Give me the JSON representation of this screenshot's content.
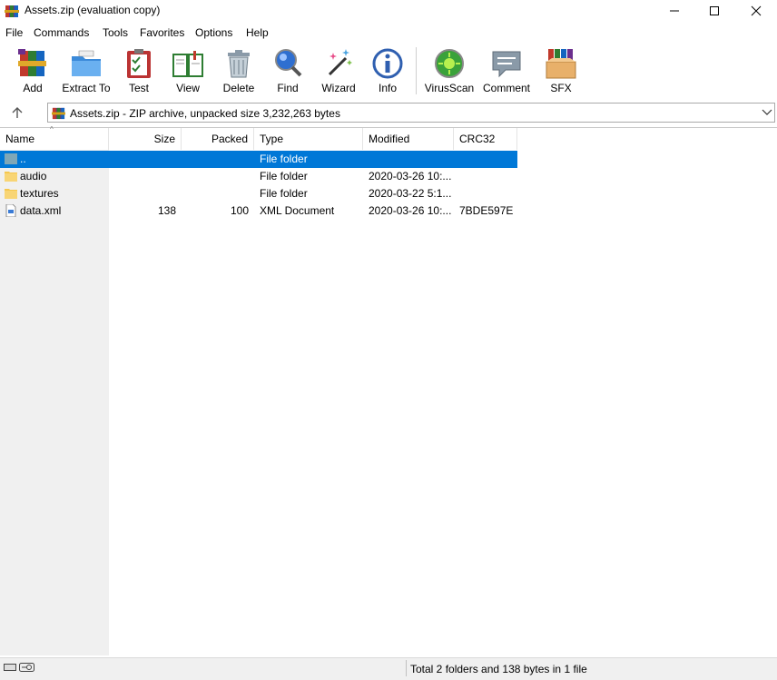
{
  "window": {
    "title": "Assets.zip (evaluation copy)",
    "icons": [
      "winrar-icon",
      "minimize-icon",
      "maximize-icon",
      "close-icon"
    ]
  },
  "menu": [
    "File",
    "Commands",
    "Tools",
    "Favorites",
    "Options",
    "Help"
  ],
  "toolbar": [
    {
      "label": "Add",
      "icon": "add-archive-icon"
    },
    {
      "label": "Extract To",
      "icon": "extract-folder-icon"
    },
    {
      "label": "Test",
      "icon": "test-clipboard-icon"
    },
    {
      "label": "View",
      "icon": "view-book-icon"
    },
    {
      "label": "Delete",
      "icon": "trash-icon"
    },
    {
      "label": "Find",
      "icon": "magnifier-icon"
    },
    {
      "label": "Wizard",
      "icon": "magic-wand-icon"
    },
    {
      "label": "Info",
      "icon": "info-icon"
    },
    {
      "label": "VirusScan",
      "icon": "virus-scan-icon"
    },
    {
      "label": "Comment",
      "icon": "comment-icon"
    },
    {
      "label": "SFX",
      "icon": "sfx-box-icon"
    }
  ],
  "address": {
    "text": "Assets.zip - ZIP archive, unpacked size 3,232,263 bytes"
  },
  "columns": [
    "Name",
    "Size",
    "Packed",
    "Type",
    "Modified",
    "CRC32"
  ],
  "rows": [
    {
      "name": "..",
      "size": "",
      "packed": "",
      "type": "File folder",
      "modified": "",
      "crc": "",
      "kind": "parent"
    },
    {
      "name": "audio",
      "size": "",
      "packed": "",
      "type": "File folder",
      "modified": "2020-03-26 10:...",
      "crc": "",
      "kind": "folder"
    },
    {
      "name": "textures",
      "size": "",
      "packed": "",
      "type": "File folder",
      "modified": "2020-03-22 5:1...",
      "crc": "",
      "kind": "folder"
    },
    {
      "name": "data.xml",
      "size": "138",
      "packed": "100",
      "type": "XML Document",
      "modified": "2020-03-26 10:...",
      "crc": "7BDE597E",
      "kind": "file"
    }
  ],
  "status": {
    "text": "Total 2 folders and 138 bytes in 1 file"
  },
  "colors": {
    "selection": "#0078d7",
    "folder": "#f5c74e",
    "tree_pane": "#f0f0f0"
  }
}
